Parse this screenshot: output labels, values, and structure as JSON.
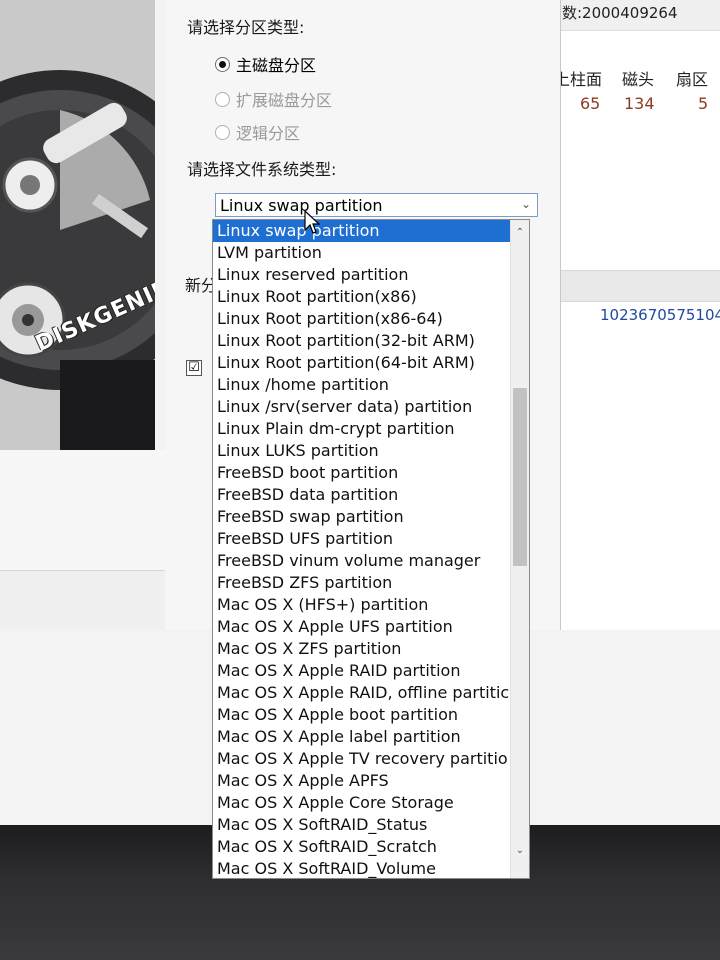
{
  "dialog": {
    "partition_type_label": "请选择分区类型:",
    "partition_types": [
      {
        "label": "主磁盘分区",
        "selected": true,
        "enabled": true
      },
      {
        "label": "扩展磁盘分区",
        "selected": false,
        "enabled": false
      },
      {
        "label": "逻辑分区",
        "selected": false,
        "enabled": false
      }
    ],
    "fs_type_label": "请选择文件系统类型:",
    "fs_selected": "Linux swap partition",
    "new_partition_label": "新分",
    "checkbox_checked": "☑"
  },
  "banner": {
    "logo": "DISKGENIUS"
  },
  "right": {
    "top_text": "数:2000409264",
    "headers": [
      "上柱面",
      "磁头",
      "扇区"
    ],
    "row": [
      "65",
      "134",
      "5"
    ],
    "big_number": "1023670575104"
  },
  "dropdown": {
    "options": [
      "Linux swap partition",
      "LVM partition",
      "Linux reserved partition",
      "Linux Root partition(x86)",
      "Linux Root partition(x86-64)",
      "Linux Root partition(32-bit ARM)",
      "Linux Root partition(64-bit ARM)",
      "Linux /home partition",
      "Linux /srv(server data) partition",
      "Linux Plain dm-crypt partition",
      "Linux LUKS partition",
      "FreeBSD boot partition",
      "FreeBSD data partition",
      "FreeBSD swap partition",
      "FreeBSD UFS partition",
      "FreeBSD vinum volume manager",
      "FreeBSD ZFS partition",
      "Mac OS X (HFS+) partition",
      "Mac OS X Apple UFS partition",
      "Mac OS X ZFS partition",
      "Mac OS X Apple RAID partition",
      "Mac OS X Apple RAID, offline partitic",
      "Mac OS X Apple boot partition",
      "Mac OS X Apple label partition",
      "Mac OS X Apple TV recovery partitio",
      "Mac OS X Apple APFS",
      "Mac OS X Apple Core Storage",
      "Mac OS X SoftRAID_Status",
      "Mac OS X SoftRAID_Scratch",
      "Mac OS X SoftRAID_Volume"
    ],
    "selected_index": 0
  },
  "icons": {
    "combo_chevron": "⌄",
    "scroll_up": "⌃",
    "scroll_down": "⌄"
  }
}
